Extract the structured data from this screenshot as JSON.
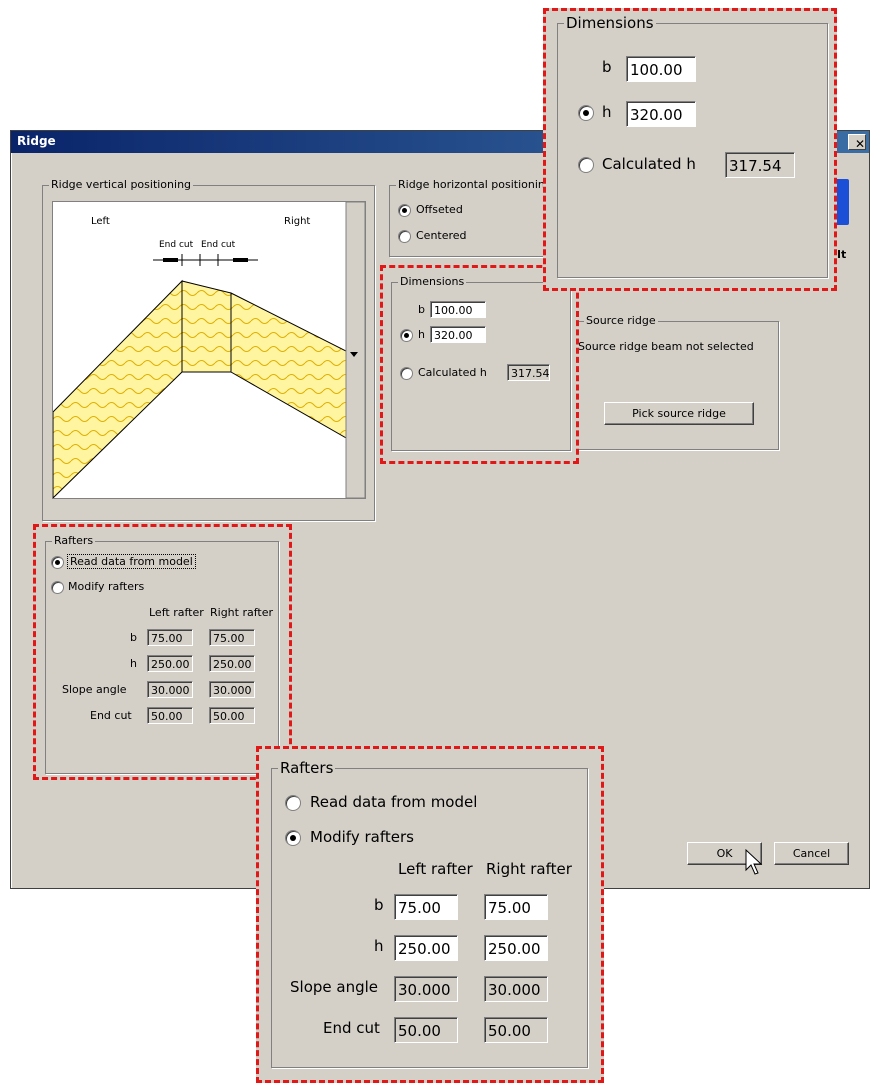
{
  "dialog": {
    "title": "Ridge",
    "close_glyph": "✕"
  },
  "vertical_positioning": {
    "title": "Ridge vertical positioning",
    "left_label": "Left",
    "right_label": "Right",
    "end_cut_left": "End cut",
    "end_cut_right": "End cut"
  },
  "horizontal_positioning": {
    "title": "Ridge horizontal positioning",
    "options": [
      {
        "label": "Offseted",
        "selected": true
      },
      {
        "label": "Centered",
        "selected": false
      }
    ]
  },
  "dimensions": {
    "title": "Dimensions",
    "b_label": "b",
    "b_value": "100.00",
    "h_label": "h",
    "h_value": "320.00",
    "calc_label": "Calculated h",
    "calc_value": "317.54",
    "selected": "h"
  },
  "source_ridge": {
    "title": "Source ridge",
    "status": "Source ridge beam not selected",
    "pick_button": "Pick source ridge"
  },
  "rafters": {
    "title": "Rafters",
    "read_option": "Read data from model",
    "modify_option": "Modify rafters",
    "col_left": "Left rafter",
    "col_right": "Right rafter",
    "rows": [
      {
        "label": "b",
        "left": "75.00",
        "right": "75.00"
      },
      {
        "label": "h",
        "left": "250.00",
        "right": "250.00"
      },
      {
        "label": "Slope angle",
        "left": "30.000",
        "right": "30.000"
      },
      {
        "label": "End cut",
        "left": "50.00",
        "right": "50.00"
      }
    ]
  },
  "rafters_zoom": {
    "selected": "modify"
  },
  "rafters_main": {
    "selected": "read"
  },
  "buttons": {
    "ok": "OK",
    "cancel": "Cancel"
  },
  "logo_text": ".lt",
  "colors": {
    "highlight": "#e01818",
    "title_bar": "#0a246a",
    "wood": "#fff5a0"
  }
}
